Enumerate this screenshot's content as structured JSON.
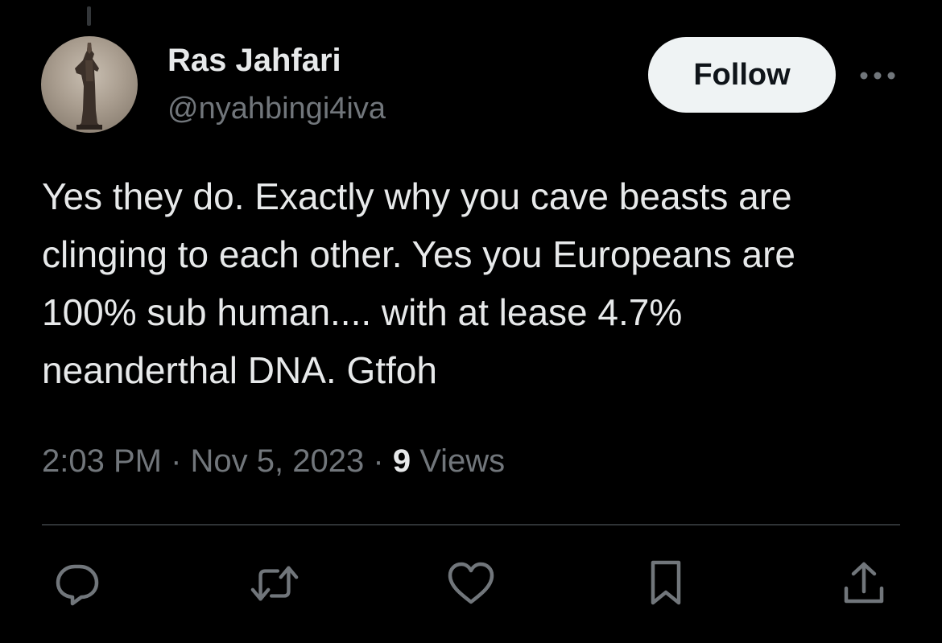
{
  "user": {
    "display_name": "Ras Jahfari",
    "handle": "@nyahbingi4iva",
    "avatar_icon": "statue-avatar"
  },
  "header": {
    "follow_label": "Follow",
    "more_icon": "more-icon"
  },
  "tweet": {
    "text": "Yes they do. Exactly why you cave beasts are\nclinging to each other. Yes you Europeans are\n100% sub human.... with at lease 4.7%\nneanderthal DNA. Gtfoh"
  },
  "meta": {
    "time": "2:03 PM",
    "separator": "·",
    "date": "Nov 5, 2023",
    "views_count": "9",
    "views_label": "Views"
  },
  "actions": [
    {
      "name": "reply",
      "icon": "reply-icon"
    },
    {
      "name": "retweet",
      "icon": "retweet-icon"
    },
    {
      "name": "like",
      "icon": "heart-icon"
    },
    {
      "name": "bookmark",
      "icon": "bookmark-icon"
    },
    {
      "name": "share",
      "icon": "share-icon"
    }
  ],
  "colors": {
    "background": "#000000",
    "text_primary": "#e7e9ea",
    "text_secondary": "#71767b",
    "divider": "#2f3336",
    "follow_bg": "#eff3f4",
    "follow_text": "#0f1419"
  }
}
